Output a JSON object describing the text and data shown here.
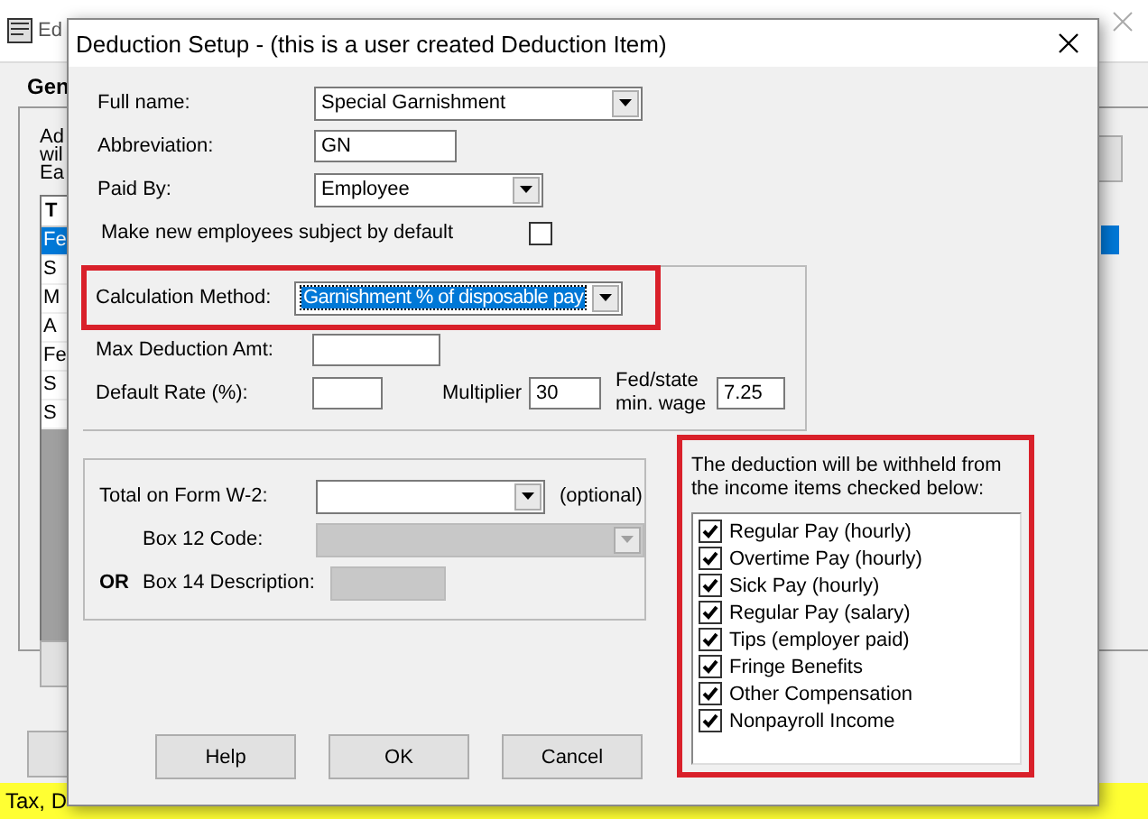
{
  "background_window": {
    "title": "Ed",
    "tab": "Gen",
    "text_lines": [
      "Ad",
      "wil",
      "Ea"
    ],
    "list_header": "T",
    "list_items": [
      {
        "label": "Fe",
        "selected": true
      },
      {
        "label": "S",
        "selected": false
      },
      {
        "label": "M",
        "selected": false
      },
      {
        "label": "A",
        "selected": false
      },
      {
        "label": "Fe",
        "selected": false
      },
      {
        "label": "S",
        "selected": false
      },
      {
        "label": "S",
        "selected": false
      }
    ],
    "status_bar": "Tax, D"
  },
  "dialog": {
    "title": "Deduction Setup - (this is a user created Deduction Item)",
    "full_name": {
      "label": "Full name:",
      "value": "Special Garnishment"
    },
    "abbreviation": {
      "label": "Abbreviation:",
      "value": "GN"
    },
    "paid_by": {
      "label": "Paid By:",
      "value": "Employee"
    },
    "subject_by_default": {
      "label": "Make new employees subject by default",
      "checked": false
    },
    "calculation_method": {
      "label": "Calculation Method:",
      "value": "Garnishment % of disposable pay",
      "highlighted": true
    },
    "max_deduction": {
      "label": "Max Deduction Amt:"
    },
    "default_rate": {
      "label": "Default Rate (%):"
    },
    "multiplier": {
      "label": "Multiplier",
      "value": "30"
    },
    "min_wage": {
      "label": "Fed/state min. wage",
      "value": "7.25"
    },
    "w2_total": {
      "label": "Total on Form W-2:",
      "note": "(optional)"
    },
    "box12": {
      "label": "Box 12 Code:",
      "disabled": true
    },
    "box14": {
      "prefix": "OR",
      "label": "Box 14 Description:",
      "disabled": true
    },
    "income_items": {
      "caption": "The deduction will be withheld from the income items checked below:",
      "highlighted": true,
      "items": [
        {
          "label": "Regular Pay (hourly)",
          "checked": true
        },
        {
          "label": "Overtime Pay (hourly)",
          "checked": true
        },
        {
          "label": "Sick Pay (hourly)",
          "checked": true
        },
        {
          "label": "Regular Pay (salary)",
          "checked": true
        },
        {
          "label": "Tips (employer paid)",
          "checked": true
        },
        {
          "label": "Fringe Benefits",
          "checked": true
        },
        {
          "label": "Other Compensation",
          "checked": true
        },
        {
          "label": "Nonpayroll Income",
          "checked": true
        }
      ]
    },
    "buttons": [
      {
        "label": "Help"
      },
      {
        "label": "OK"
      },
      {
        "label": "Cancel"
      }
    ]
  }
}
